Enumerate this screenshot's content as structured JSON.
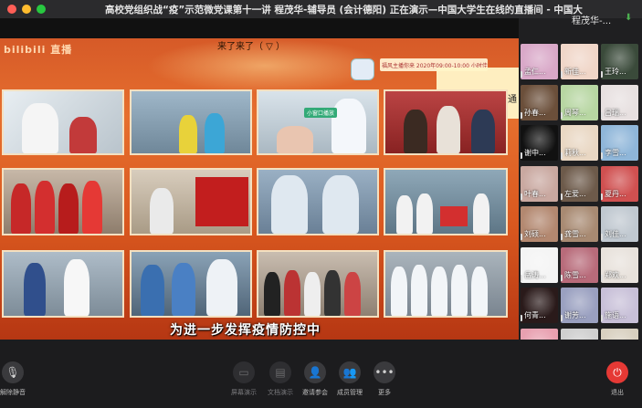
{
  "window": {
    "title": "高校党组织战“疫”示范微党课第十一讲   程茂华-辅导员 (会计德阳) 正在演示—中国大学生在线的直播间 - 中国大",
    "lights": [
      "#ff5f57",
      "#febc2e",
      "#28c840"
    ]
  },
  "slide": {
    "logo": "bilibili 直播",
    "caption_top": "来了来了（  ▽  ）",
    "banner": "福风主播你来 2020年09:00-10:00 小时佳绩第一名",
    "bili_char": "通",
    "photo_tag": "小窗口播放",
    "subtitle": "为进一步发挥疫情防控中"
  },
  "panel": {
    "self_name": "程茂华-...",
    "participants": [
      {
        "name": "孟仁..."
      },
      {
        "name": "新佳..."
      },
      {
        "name": "王玲..."
      },
      {
        "name": "孙春..."
      },
      {
        "name": "周琴..."
      },
      {
        "name": "吕瑞..."
      },
      {
        "name": "谢中..."
      },
      {
        "name": "莉秋..."
      },
      {
        "name": "李雪..."
      },
      {
        "name": "叶春..."
      },
      {
        "name": "左爱..."
      },
      {
        "name": "夏丹..."
      },
      {
        "name": "刘硕..."
      },
      {
        "name": "龚雪..."
      },
      {
        "name": "刘佳..."
      },
      {
        "name": "岳涛..."
      },
      {
        "name": "陈雪..."
      },
      {
        "name": "郑欢..."
      },
      {
        "name": "何青..."
      },
      {
        "name": "谢芳..."
      },
      {
        "name": "施语..."
      },
      {
        "name": ""
      },
      {
        "name": ""
      },
      {
        "name": ""
      }
    ]
  },
  "toolbar": {
    "mute": "解除静音",
    "screen_share": "屏幕演示",
    "doc_share": "文档演示",
    "invite": "邀请参会",
    "members": "成员管理",
    "more": "更多",
    "leave": "退出"
  }
}
